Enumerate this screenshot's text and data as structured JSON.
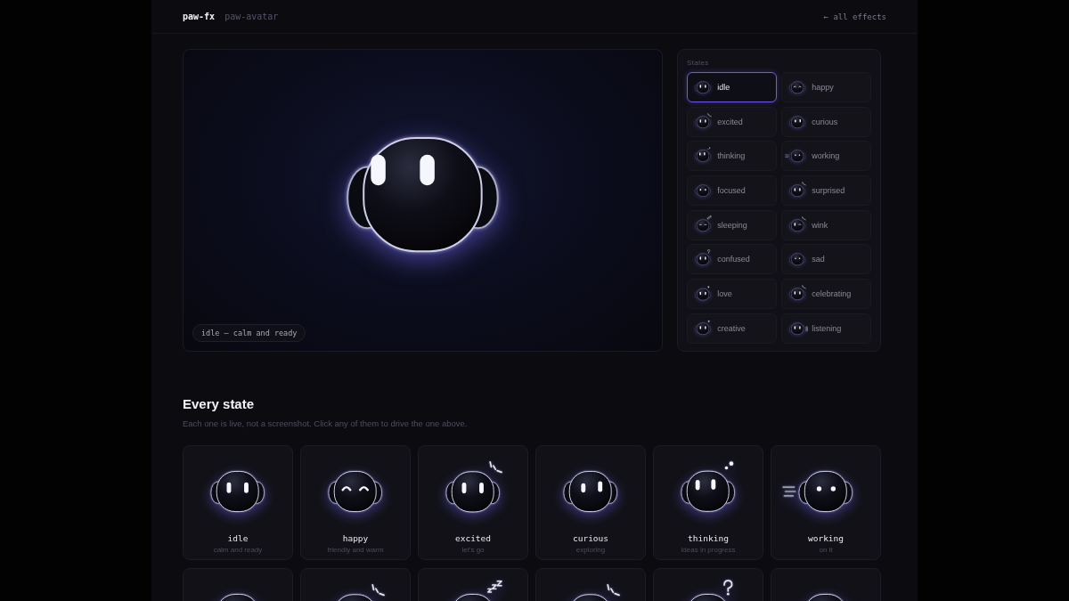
{
  "header": {
    "logo": "paw-fx",
    "page": "paw-avatar",
    "back_link": "← all effects"
  },
  "preview": {
    "kind": "idle",
    "caption": "idle — calm and ready"
  },
  "states_panel": {
    "title": "States",
    "items": [
      {
        "label": "idle",
        "kind": "idle",
        "selected": true
      },
      {
        "label": "happy",
        "kind": "happy",
        "selected": false
      },
      {
        "label": "excited",
        "kind": "excited",
        "selected": false
      },
      {
        "label": "curious",
        "kind": "curious",
        "selected": false
      },
      {
        "label": "thinking",
        "kind": "thinking",
        "selected": false
      },
      {
        "label": "working",
        "kind": "working",
        "selected": false
      },
      {
        "label": "focused",
        "kind": "focused",
        "selected": false
      },
      {
        "label": "surprised",
        "kind": "surprised",
        "selected": false
      },
      {
        "label": "sleeping",
        "kind": "sleeping",
        "selected": false
      },
      {
        "label": "wink",
        "kind": "wink",
        "selected": false
      },
      {
        "label": "confused",
        "kind": "confused",
        "selected": false
      },
      {
        "label": "sad",
        "kind": "sad",
        "selected": false
      },
      {
        "label": "love",
        "kind": "love",
        "selected": false
      },
      {
        "label": "celebrating",
        "kind": "celebrating",
        "selected": false
      },
      {
        "label": "creative",
        "kind": "creative",
        "selected": false
      },
      {
        "label": "listening",
        "kind": "listening",
        "selected": false
      }
    ]
  },
  "gallery": {
    "title": "Every state",
    "subtitle": "Each one is live, not a screenshot. Click any of them to drive the one above.",
    "cards": [
      {
        "kind": "idle",
        "name": "idle",
        "description": "calm and ready"
      },
      {
        "kind": "happy",
        "name": "happy",
        "description": "friendly and warm"
      },
      {
        "kind": "excited",
        "name": "excited",
        "description": "let's go"
      },
      {
        "kind": "curious",
        "name": "curious",
        "description": "exploring"
      },
      {
        "kind": "thinking",
        "name": "thinking",
        "description": "ideas in progress"
      },
      {
        "kind": "working",
        "name": "working",
        "description": "on it"
      },
      {
        "kind": "focused"
      },
      {
        "kind": "surprised"
      },
      {
        "kind": "sleeping"
      },
      {
        "kind": "wink"
      },
      {
        "kind": "confused"
      },
      {
        "kind": "sad"
      }
    ]
  }
}
